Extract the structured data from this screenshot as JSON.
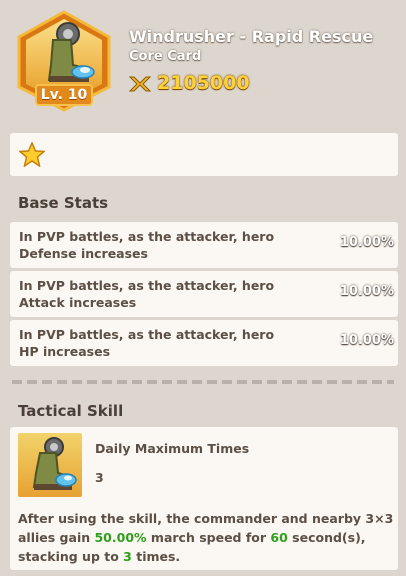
{
  "card": {
    "name": "Windrusher - Rapid Rescue",
    "type": "Core Card",
    "level": "Lv. 10",
    "score": "2105000",
    "icon": "boot-icon"
  },
  "stars": 1,
  "base_stats": {
    "title": "Base Stats",
    "rows": [
      {
        "text": "In PVP battles, as the attacker, hero\nDefense increases",
        "value": "10.00%"
      },
      {
        "text": "In PVP battles, as the attacker, hero\nAttack increases",
        "value": "10.00%"
      },
      {
        "text": "In PVP battles, as the attacker, hero\nHP increases",
        "value": "10.00%"
      }
    ]
  },
  "tactical_skill": {
    "title": "Tactical Skill",
    "label": "Daily Maximum Times",
    "value": "3",
    "desc_1": "After using the skill, the commander and nearby 3×3 allies gain ",
    "pct": "50.00%",
    "desc_2": " march speed for ",
    "seconds": "60",
    "desc_3": " second(s), stacking up to ",
    "stacks": "3",
    "desc_4": " times."
  },
  "colors": {
    "background": "#ddd6ce",
    "panel": "#fbf7f2",
    "highlight": "#2ea01c",
    "score": "#ffd23a"
  }
}
